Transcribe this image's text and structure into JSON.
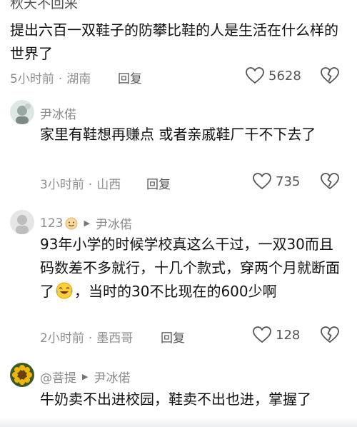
{
  "top_cutoff_text": "秋天不回来",
  "comments": [
    {
      "text": "提出六百一双鞋子的防攀比鞋的人是生活在什么样的世界了",
      "time": "5小时前",
      "location": "湖南",
      "reply_label": "回复",
      "likes": "5628"
    },
    {
      "username": "尹冰偌",
      "text": "家里有鞋想再赚点 或者亲戚鞋厂干不下去了",
      "time": "3小时前",
      "location": "山西",
      "reply_label": "回复",
      "likes": "735"
    },
    {
      "username": "123",
      "reply_to": "尹冰偌",
      "text_part1": "93年小学的时候学校真这么干过，一双30而且码数差不多就行，十几个款式，穿两个月就断面了",
      "text_part2": "，当时的30不比现在的600少啊",
      "emoji": "laughing-crying",
      "time": "2小时前",
      "location": "墨西哥",
      "reply_label": "回复",
      "likes": "128"
    },
    {
      "username": "@菩提",
      "reply_to": "尹冰偌",
      "text": "牛奶卖不出进校园，鞋卖不出也进，掌握了"
    }
  ],
  "colors": {
    "text": "#111111",
    "meta": "#8e8e8e",
    "icon": "#555555"
  }
}
